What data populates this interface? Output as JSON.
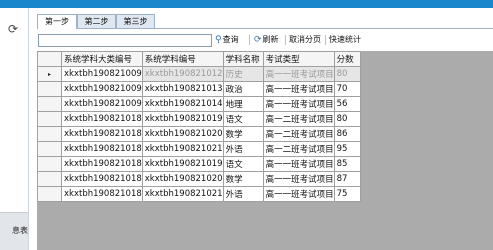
{
  "sidebar": {
    "refresh_icon": "refresh-icon",
    "bottom_label": "息表"
  },
  "tabs": [
    {
      "label": "第一步",
      "active": true
    },
    {
      "label": "第二步",
      "active": false
    },
    {
      "label": "第三步",
      "active": false
    }
  ],
  "toolbar": {
    "search_value": "",
    "query_label": "查询",
    "refresh_label": "刷新",
    "cancel_paging_label": "取消分页",
    "quick_stats_label": "快速统计",
    "query_icon": "search-icon",
    "refresh_icon": "refresh-icon"
  },
  "grid": {
    "columns": [
      "系统学科大类编号",
      "系统学科编号",
      "学科名称",
      "考试类型",
      "分数"
    ],
    "current_row_marker": "▸",
    "rows": [
      [
        "xkxtbh190821009",
        "xkxtbh190821012",
        "历史",
        "高一一班考试项目",
        "80"
      ],
      [
        "xkxtbh190821009",
        "xkxtbh190821013",
        "政治",
        "高一一班考试项目",
        "70"
      ],
      [
        "xkxtbh190821009",
        "xkxtbh190821014",
        "地理",
        "高一一班考试项目",
        "56"
      ],
      [
        "xkxtbh190821018",
        "xkxtbh190821019",
        "语文",
        "高一二班考试项目",
        "80"
      ],
      [
        "xkxtbh190821018",
        "xkxtbh190821020",
        "数学",
        "高一二班考试项目",
        "86"
      ],
      [
        "xkxtbh190821018",
        "xkxtbh190821021",
        "外语",
        "高一二班考试项目",
        "95"
      ],
      [
        "xkxtbh190821018",
        "xkxtbh190821019",
        "语文",
        "高一一班考试项目",
        "85"
      ],
      [
        "xkxtbh190821018",
        "xkxtbh190821020",
        "数学",
        "高一一班考试项目",
        "87"
      ],
      [
        "xkxtbh190821018",
        "xkxtbh190821021",
        "外语",
        "高一一班考试项目",
        "75"
      ]
    ]
  },
  "colors": {
    "title_bar": "#1a86cc",
    "grid_background": "#ababab",
    "selected_cell": "#e6e6e6"
  }
}
